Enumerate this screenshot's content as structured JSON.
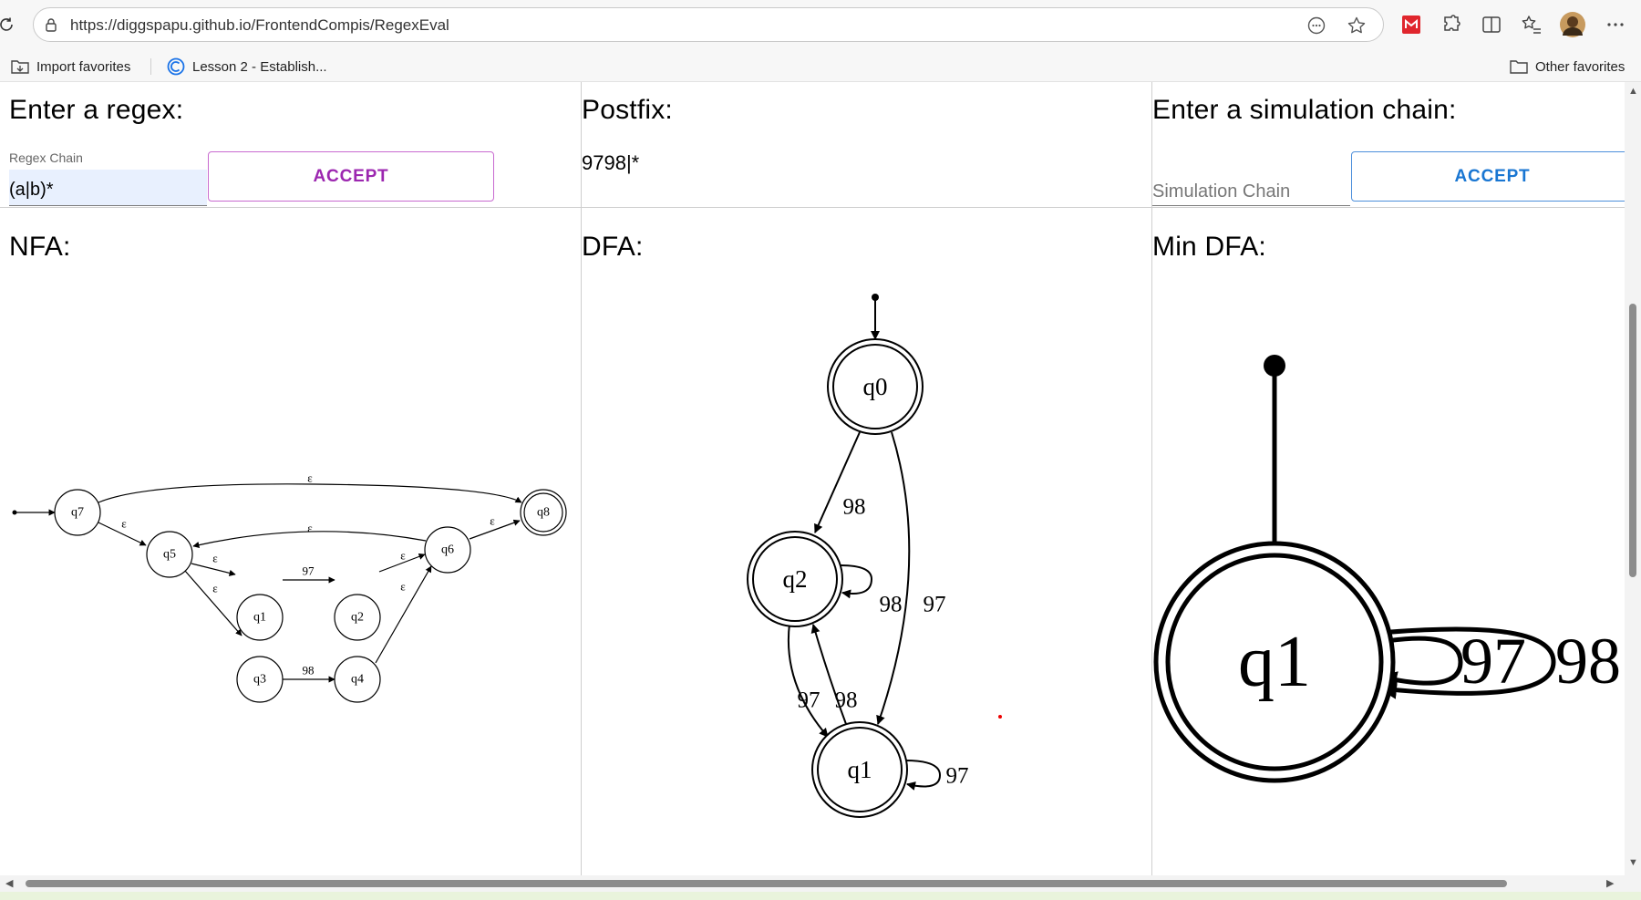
{
  "browser": {
    "url": "https://diggspapu.github.io/FrontendCompis/RegexEval",
    "bookmarks": [
      {
        "label": "Import favorites",
        "icon": "import-folder-icon"
      },
      {
        "label": "Lesson 2 - Establish...",
        "icon": "site-favicon-icon"
      }
    ],
    "other_favorites": "Other favorites"
  },
  "regex_panel": {
    "heading": "Enter a regex:",
    "field_label": "Regex Chain",
    "value": "(a|b)*",
    "accept_label": "ACCEPT",
    "accent_color": "#9c27b0"
  },
  "postfix_panel": {
    "heading": "Postfix:",
    "value": "9798|*"
  },
  "simulation_panel": {
    "heading": "Enter a simulation chain:",
    "placeholder": "Simulation Chain",
    "accept_label": "ACCEPT",
    "accent_color": "#1976d2"
  },
  "nfa": {
    "heading": "NFA:",
    "states": [
      "q7",
      "q5",
      "q1",
      "q2",
      "q3",
      "q4",
      "q6",
      "q8"
    ],
    "start": "q7",
    "accepting": [
      "q8"
    ],
    "transitions": [
      {
        "from": "q7",
        "to": "q8",
        "label": "ε"
      },
      {
        "from": "q7",
        "to": "q5",
        "label": "ε"
      },
      {
        "from": "q6",
        "to": "q5",
        "label": "ε"
      },
      {
        "from": "q5",
        "to": "q1",
        "label": "ε"
      },
      {
        "from": "q5",
        "to": "q3",
        "label": "ε"
      },
      {
        "from": "q1",
        "to": "q2",
        "label": "97"
      },
      {
        "from": "q3",
        "to": "q4",
        "label": "98"
      },
      {
        "from": "q2",
        "to": "q6",
        "label": "ε"
      },
      {
        "from": "q4",
        "to": "q6",
        "label": "ε"
      },
      {
        "from": "q6",
        "to": "q8",
        "label": "ε"
      }
    ]
  },
  "dfa": {
    "heading": "DFA:",
    "states": [
      "q0",
      "q2",
      "q1"
    ],
    "start": "q0",
    "accepting": [
      "q0",
      "q2",
      "q1"
    ],
    "transitions": [
      {
        "from": "q0",
        "to": "q2",
        "label": "98"
      },
      {
        "from": "q0",
        "to": "q1",
        "label": "97"
      },
      {
        "from": "q2",
        "to": "q2",
        "label": "98"
      },
      {
        "from": "q2",
        "to": "q1",
        "label": "97"
      },
      {
        "from": "q1",
        "to": "q2",
        "label": "98"
      },
      {
        "from": "q1",
        "to": "q1",
        "label": "97"
      }
    ]
  },
  "min_dfa": {
    "heading": "Min DFA:",
    "states": [
      "q1"
    ],
    "start": "q1",
    "accepting": [
      "q1"
    ],
    "transitions": [
      {
        "from": "q1",
        "to": "q1",
        "label": "97"
      },
      {
        "from": "q1",
        "to": "q1",
        "label": "98"
      }
    ]
  }
}
